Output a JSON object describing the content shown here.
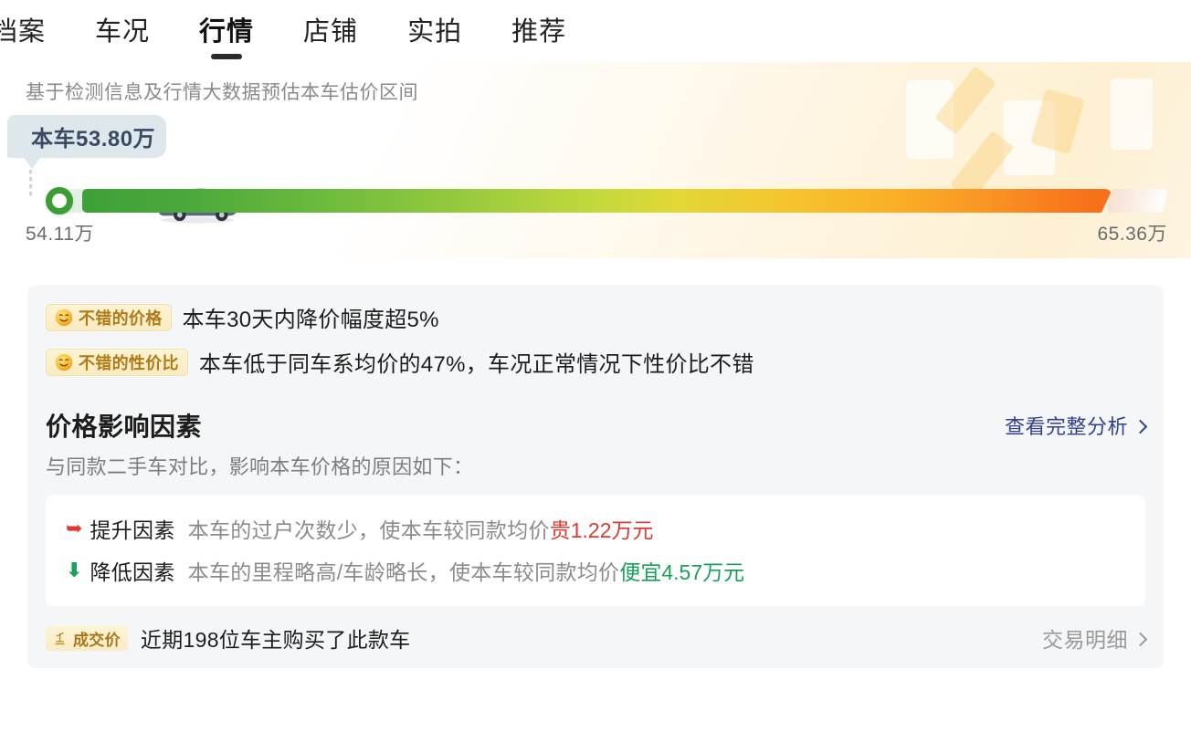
{
  "nav": {
    "items": [
      {
        "label": "档案",
        "active": false
      },
      {
        "label": "车况",
        "active": false
      },
      {
        "label": "行情",
        "active": true
      },
      {
        "label": "店铺",
        "active": false
      },
      {
        "label": "实拍",
        "active": false
      },
      {
        "label": "推荐",
        "active": false
      }
    ]
  },
  "hero": {
    "subtitle": "基于检测信息及行情大数据预估本车估价区间",
    "bubble_label": "本车53.80万",
    "car_price": "53.80万",
    "range_min": "54.11万",
    "range_max": "65.36万",
    "marker_position_pct": 0,
    "gradient_start_color": "#3da038",
    "gradient_end_color": "#f56f19",
    "marker_color": "#3a9e35"
  },
  "taglines": [
    {
      "badge_icon": "smile-emoji",
      "badge_label": "不错的价格",
      "text": "本车30天内降价幅度超5%"
    },
    {
      "badge_icon": "smile-emoji",
      "badge_label": "不错的性价比",
      "text": "本车低于同车系均价的47%，车况正常情况下性价比不错"
    }
  ],
  "factors_section": {
    "title": "价格影响因素",
    "link_label": "查看完整分析",
    "link_icon": "chevron-right-icon",
    "description": "与同款二手车对比，影响本车价格的原因如下：",
    "rows": [
      {
        "arrow_icon": "arrow-up-icon",
        "kind": "提升因素",
        "reason": "本车的过户次数少",
        "middle": "，使本车较同款均价",
        "amount": "贵1.22万元",
        "direction": "up",
        "color": "#e03a2f"
      },
      {
        "arrow_icon": "arrow-down-icon",
        "kind": "降低因素",
        "reason": "本车的里程略高/车龄略长",
        "middle": "，使本车较同款均价",
        "amount": "便宜4.57万元",
        "direction": "down",
        "color": "#18a05a"
      }
    ]
  },
  "deal": {
    "badge_icon": "gavel-icon",
    "badge_label": "成交价",
    "text": "近期198位车主购买了此款车",
    "link_label": "交易明细",
    "link_icon": "chevron-right-icon"
  }
}
